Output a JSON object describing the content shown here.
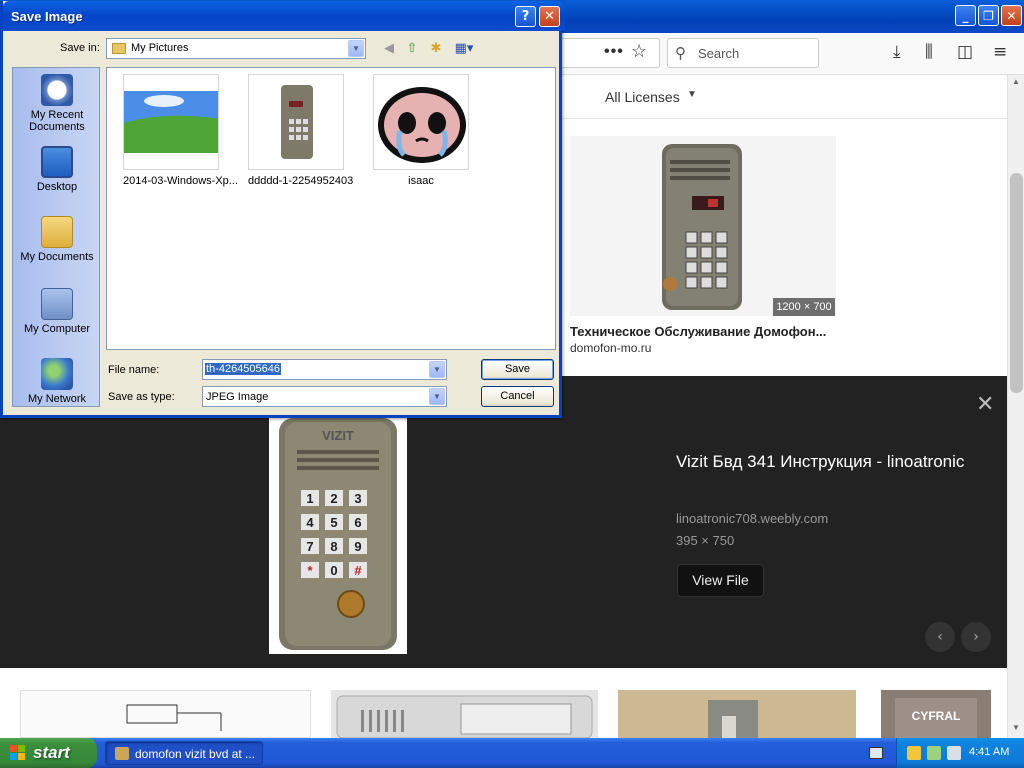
{
  "browser": {
    "search_placeholder": "Search",
    "filter_license": "All Licenses",
    "result": {
      "size_badge": "1200 × 700",
      "title": "Техническое Обслуживание Домофон...",
      "domain": "domofon-mo.ru"
    },
    "detail": {
      "title": "Vizit Бвд 341 Инструкция - linoatronic",
      "domain": "linoatronic708.weebly.com",
      "dimensions": "395 × 750",
      "view_button": "View File"
    }
  },
  "dialog": {
    "title": "Save Image",
    "save_in_label": "Save in:",
    "save_in_value": "My Pictures",
    "places": [
      "My Recent Documents",
      "Desktop",
      "My Documents",
      "My Computer",
      "My Network"
    ],
    "files": [
      {
        "name": "2014-03-Windows-Xp..."
      },
      {
        "name": "ddddd-1-2254952403"
      },
      {
        "name": "isaac"
      }
    ],
    "file_name_label": "File name:",
    "file_name_value": "th-4264505646",
    "save_type_label": "Save as type:",
    "save_type_value": "JPEG Image",
    "save_button": "Save",
    "cancel_button": "Cancel"
  },
  "taskbar": {
    "start_label": "start",
    "task_label": "domofon vizit bvd at ...",
    "clock": "4:41 AM"
  },
  "colors": {
    "xp_blue": "#0842c0",
    "dark_panel": "#222222",
    "start_green": "#3c8f3c"
  }
}
